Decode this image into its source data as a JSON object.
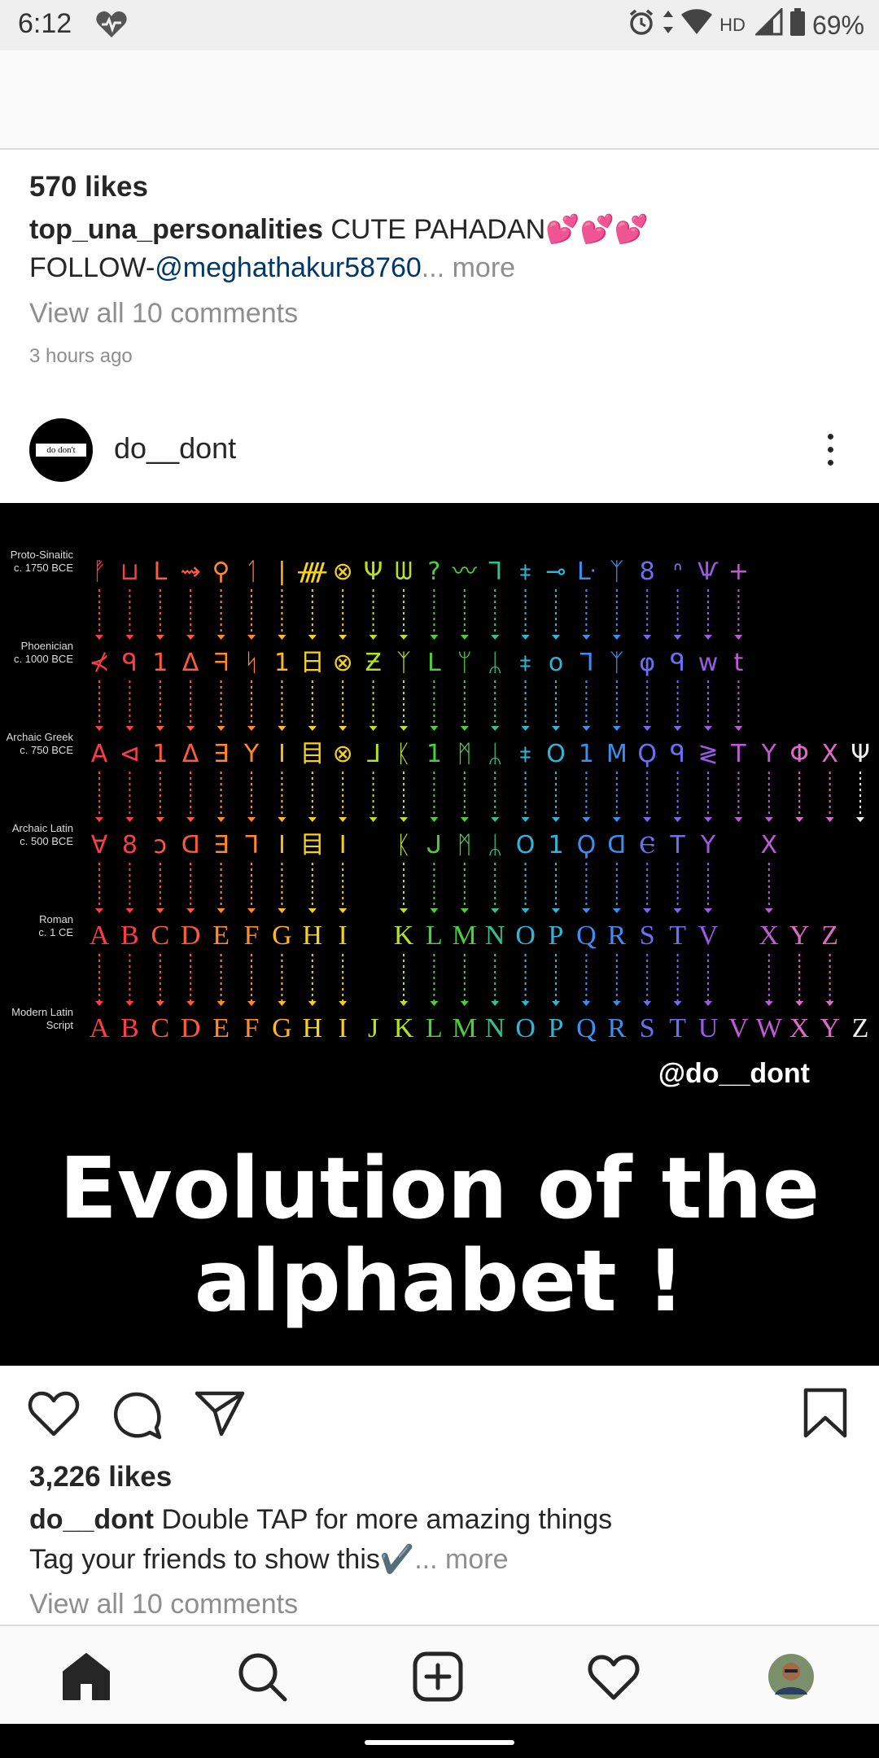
{
  "status_bar": {
    "time": "6:12",
    "network": "HD",
    "battery": "69%"
  },
  "previous_post": {
    "likes": "570 likes",
    "username": "top_una_personalities",
    "caption": "CUTE PAHADAN💕💕💕",
    "caption_line2_prefix": "FOLLOW-",
    "mention": "@meghathakur58760",
    "ellipsis": "...",
    "more": "more",
    "view_comments": "View all 10 comments",
    "time_ago": "3 hours ago"
  },
  "post": {
    "username": "do__dont",
    "avatar_text": "do don't",
    "image": {
      "rows": [
        {
          "label1": "Proto-Sinaitic",
          "label2": "c. 1750 BCE"
        },
        {
          "label1": "Phoenician",
          "label2": "c. 1000 BCE"
        },
        {
          "label1": "Archaic Greek",
          "label2": "c. 750 BCE"
        },
        {
          "label1": "Archaic Latin",
          "label2": "c. 500 BCE"
        },
        {
          "label1": "Roman",
          "label2": "c. 1 CE"
        },
        {
          "label1": "Modern Latin",
          "label2": "Script"
        }
      ],
      "row_glyphs": [
        "ᚡ⊔ᒪ⇝⚲ᛐ|ᚎ⊗Ψᗯ?〰ᒣ⧧⊸ᒷᛉ8ᐢѰ+",
        "⊀ᑫ1ᐃᖷᛋ1日⊗Ƶᛉᒪᛘᛦ⧧ᴏᒣᛉφᑫwt",
        "A⊲1Δ∃YI目⊗ᒧᛕ1ᛗᛦ⧧O1MϘᑫ≷TYΦXΨ",
        "Ɐ8ↄᗡ∃ᒣI目I ᛕᒍᛗᛦO1ϘᗡⲈTY X",
        "ABCDEFGHI KLMNOPQRSTV XYZ",
        "ABCDEFGHIJKLMNOPQRSTUVWXYZ"
      ],
      "watermark": "@do__dont",
      "headline_line1": "Evolution of the",
      "headline_line2": "alphabet !"
    },
    "likes": "3,226 likes",
    "caption": "Double TAP for more amazing things",
    "caption_line2": "Tag your friends to show this✔️",
    "ellipsis": "...",
    "more": "more",
    "view_comments": "View all 10 comments"
  },
  "colors": {
    "rainbow": [
      "#ff3b46",
      "#ff5a3c",
      "#ff8a2a",
      "#ffb62a",
      "#f5d21c",
      "#b6e21e",
      "#4ccf3a",
      "#2fc48d",
      "#32b4d6",
      "#3c8ff0",
      "#6b6ff2",
      "#9b59e6",
      "#c05ad6",
      "#e06ac8",
      "#f0f0f0"
    ]
  },
  "icons": {
    "status_heart": "heart-badge-icon",
    "alarm": "alarm-icon",
    "data": "data-arrows-icon",
    "wifi": "wifi-icon",
    "signal": "signal-icon",
    "battery": "battery-icon",
    "like": "heart-outline-icon",
    "comment": "comment-bubble-icon",
    "share": "paper-plane-icon",
    "save": "bookmark-icon",
    "home": "home-icon",
    "search": "search-icon",
    "new_post": "add-post-icon",
    "activity": "heart-outline-icon",
    "profile": "profile-avatar-icon"
  }
}
